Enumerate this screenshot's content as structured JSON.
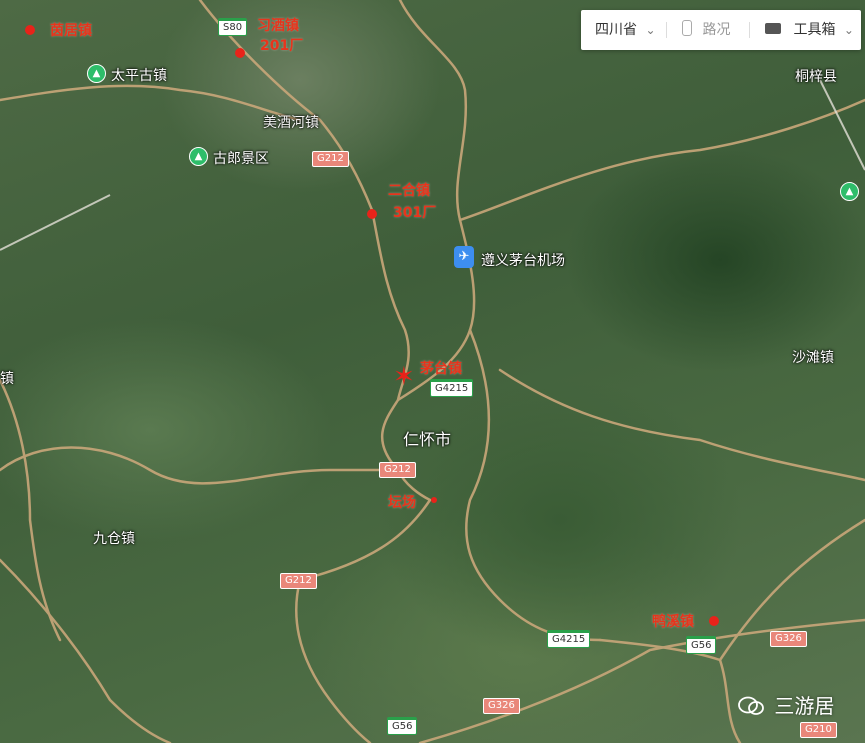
{
  "toolbar": {
    "province": "四川省",
    "traffic": "路况",
    "tools": "工具箱",
    "province_icon": "chevron-down-icon",
    "traffic_icon": "traffic-light-icon",
    "tools_icon": "toolbox-icon",
    "tools_chevron": "chevron-down-icon"
  },
  "places": {
    "caoju": "茵居镇",
    "xijiu": "习酒镇",
    "xijiu_note": "201厂",
    "taiping": "太平古镇",
    "meijiuhe": "美酒河镇",
    "gulang": "古郎景区",
    "erhe": "二合镇",
    "erhe_note": "301厂",
    "airport": "遵义茅台机场",
    "tongzi": "桐梓县",
    "maotai": "茅台镇",
    "renhuai": "仁怀市",
    "tanchang": "坛场",
    "shatan": "沙滩镇",
    "jiucang": "九仓镇",
    "yaxi": "鸭溪镇",
    "edge_left": "镇"
  },
  "routes": {
    "s80": "S80",
    "g212_a": "G212",
    "g212_b": "G212",
    "g212_c": "G212",
    "g4215_a": "G4215",
    "g4215_b": "G4215",
    "g56_a": "G56",
    "g56_b": "G56",
    "g326_a": "G326",
    "g326_b": "G326",
    "g210": "G210"
  },
  "watermark": "三游居",
  "colors": {
    "marker_red": "#e8231a",
    "label_red": "#e8341c",
    "scenic_green": "#2ebd6a",
    "airport_blue": "#3d8ef0",
    "road_tan": "#c9a77a"
  }
}
